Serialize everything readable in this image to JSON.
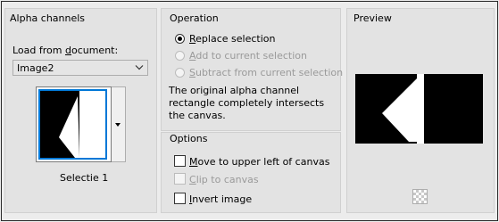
{
  "alpha": {
    "title": "Alpha channels",
    "load_label_pre": "Load from ",
    "load_label_u": "d",
    "load_label_post": "ocument:",
    "document_value": "Image2",
    "thumb_caption": "Selectie 1"
  },
  "operation": {
    "title": "Operation",
    "replace_u": "R",
    "replace_rest": "eplace selection",
    "add_u": "A",
    "add_rest": "dd to current selection",
    "subtract_u": "S",
    "subtract_rest": "ubtract from current selection",
    "message": "The original alpha channel rectangle completely intersects the canvas."
  },
  "options": {
    "title": "Options",
    "move_u": "M",
    "move_rest": "ove to upper left of canvas",
    "clip_u": "C",
    "clip_rest": "lip to canvas",
    "invert_u": "I",
    "invert_rest": "nvert image"
  },
  "preview": {
    "title": "Preview"
  },
  "colors": {
    "selection_blue": "#0078d7",
    "disabled_text": "#9a9a9a"
  }
}
